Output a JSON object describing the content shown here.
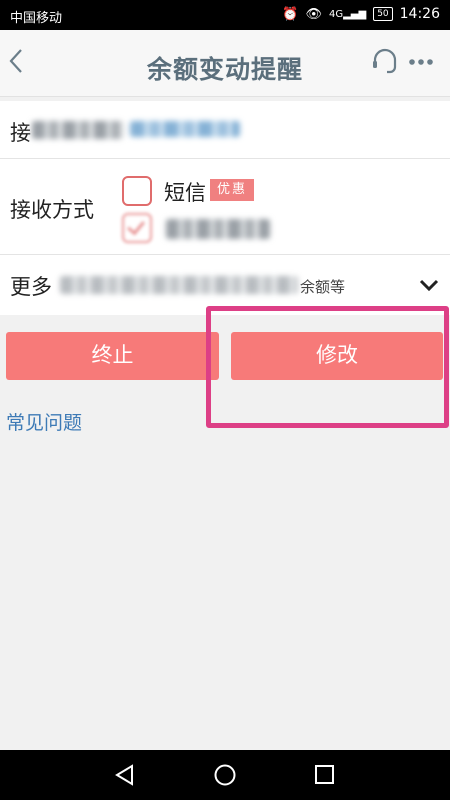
{
  "status_bar": {
    "carrier": "中国移动",
    "network": "4G",
    "battery": "50",
    "time": "14:26",
    "icons": [
      "alarm-icon",
      "eye-icon",
      "signal-icon",
      "battery-icon"
    ]
  },
  "header": {
    "title": "余额变动提醒",
    "back_icon": "chevron-left-icon",
    "service_icon": "headset-icon",
    "more_icon": "more-icon"
  },
  "form": {
    "receiver": {
      "label_prefix": "接"
    },
    "method": {
      "label": "接收方式",
      "options": [
        {
          "label": "短信",
          "badge": "优惠",
          "checked": false
        },
        {
          "checked": true
        }
      ]
    },
    "more": {
      "label_prefix": "更多",
      "visible_tail": "余额等"
    }
  },
  "actions": {
    "stop_label": "终止",
    "modify_label": "修改"
  },
  "faq_link": "常见问题",
  "colors": {
    "accent": "#f77a79",
    "title": "#5b6f7c",
    "link": "#3d7ab6",
    "highlight": "#dd3f86"
  }
}
